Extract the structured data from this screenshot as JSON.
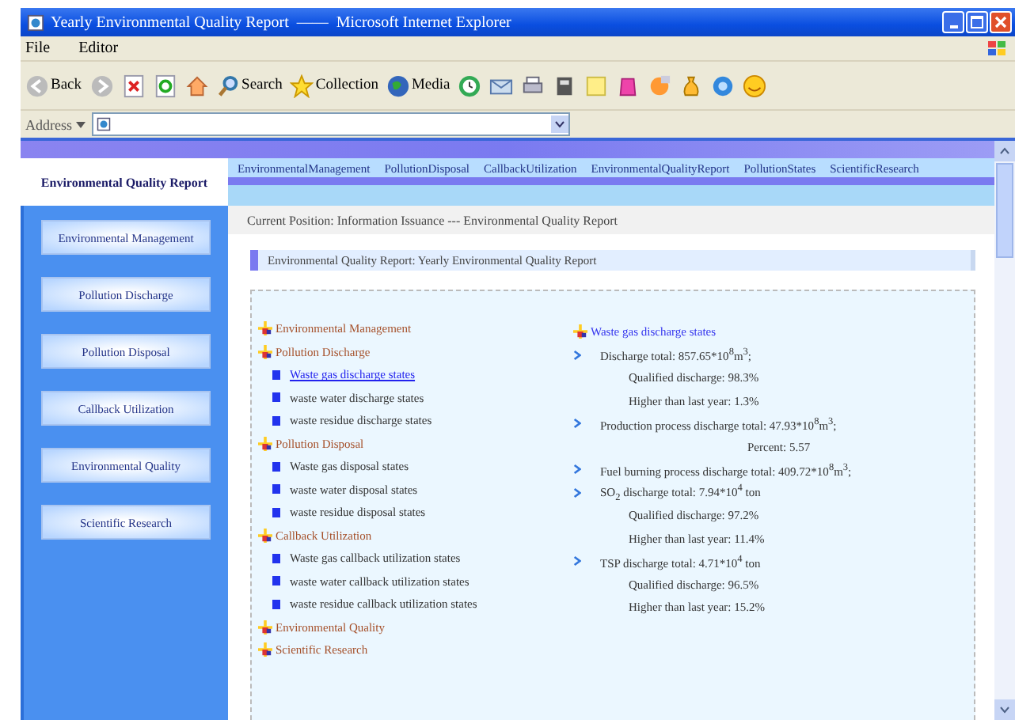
{
  "window": {
    "title": "Yearly Environmental Quality Report  ——  Microsoft Internet Explorer"
  },
  "menu": [
    "File",
    "Editor"
  ],
  "toolbar": [
    "Back",
    "Search",
    "Collection",
    "Media"
  ],
  "address": {
    "label": "Address"
  },
  "site_title": "Environmental Quality Report",
  "sidebar": [
    {
      "label": "Environmental Management"
    },
    {
      "label": "Pollution Discharge"
    },
    {
      "label": "Pollution Disposal"
    },
    {
      "label": "Callback Utilization"
    },
    {
      "label": "Environmental Quality"
    },
    {
      "label": "Scientific Research"
    }
  ],
  "nav": [
    "EnvironmentalManagement",
    "PollutionDisposal",
    "CallbackUtilization",
    "EnvironmentalQualityReport",
    "PollutionStates",
    "ScientificResearch"
  ],
  "breadcrumb": "Current Position: Information Issuance --- Environmental Quality Report",
  "heading": "Environmental Quality Report: Yearly Environmental Quality Report",
  "tree": [
    {
      "label": "Environmental Management"
    },
    {
      "label": "Pollution Discharge",
      "children": [
        {
          "label": "Waste gas discharge states",
          "selected": true
        },
        {
          "label": "waste water discharge states",
          "selected": false
        },
        {
          "label": "waste residue discharge states",
          "selected": false
        }
      ]
    },
    {
      "label": "Pollution Disposal",
      "children": [
        {
          "label": "Waste gas disposal states",
          "selected": false
        },
        {
          "label": "waste water disposal states",
          "selected": false
        },
        {
          "label": "waste residue disposal states",
          "selected": false
        }
      ]
    },
    {
      "label": "Callback Utilization",
      "children": [
        {
          "label": "Waste gas callback utilization states",
          "selected": false
        },
        {
          "label": "waste water callback utilization states",
          "selected": false
        },
        {
          "label": "waste residue callback utilization states",
          "selected": false
        }
      ]
    },
    {
      "label": "Environmental Quality"
    },
    {
      "label": "Scientific Research"
    }
  ],
  "detail": {
    "title": "Waste gas discharge states",
    "lines": [
      {
        "kind": "bullet",
        "text": "Discharge total: 857.65*10$^{8}$m$^{3}$;"
      },
      {
        "kind": "sub",
        "text": "Qualified discharge: 98.3%"
      },
      {
        "kind": "sub",
        "text": "Higher than last year: 1.3%"
      },
      {
        "kind": "bullet",
        "text": "Production process discharge total: 47.93*10$^{8}$m$^{3}$;"
      },
      {
        "kind": "far",
        "text": "Percent: 5.57"
      },
      {
        "kind": "bullet",
        "text": "Fuel burning process discharge total: 409.72*10$^{8}$m$^{3}$;"
      },
      {
        "kind": "bullet",
        "text": "SO$_{2}$ discharge total: 7.94*10$^{4}$ ton"
      },
      {
        "kind": "sub",
        "text": "Qualified discharge: 97.2%"
      },
      {
        "kind": "sub",
        "text": "Higher than last year: 11.4%"
      },
      {
        "kind": "bullet",
        "text": "TSP discharge total: 4.71*10$^{4}$ ton"
      },
      {
        "kind": "sub",
        "text": "Qualified discharge: 96.5%"
      },
      {
        "kind": "sub",
        "text": "Higher than last year: 15.2%"
      }
    ]
  }
}
